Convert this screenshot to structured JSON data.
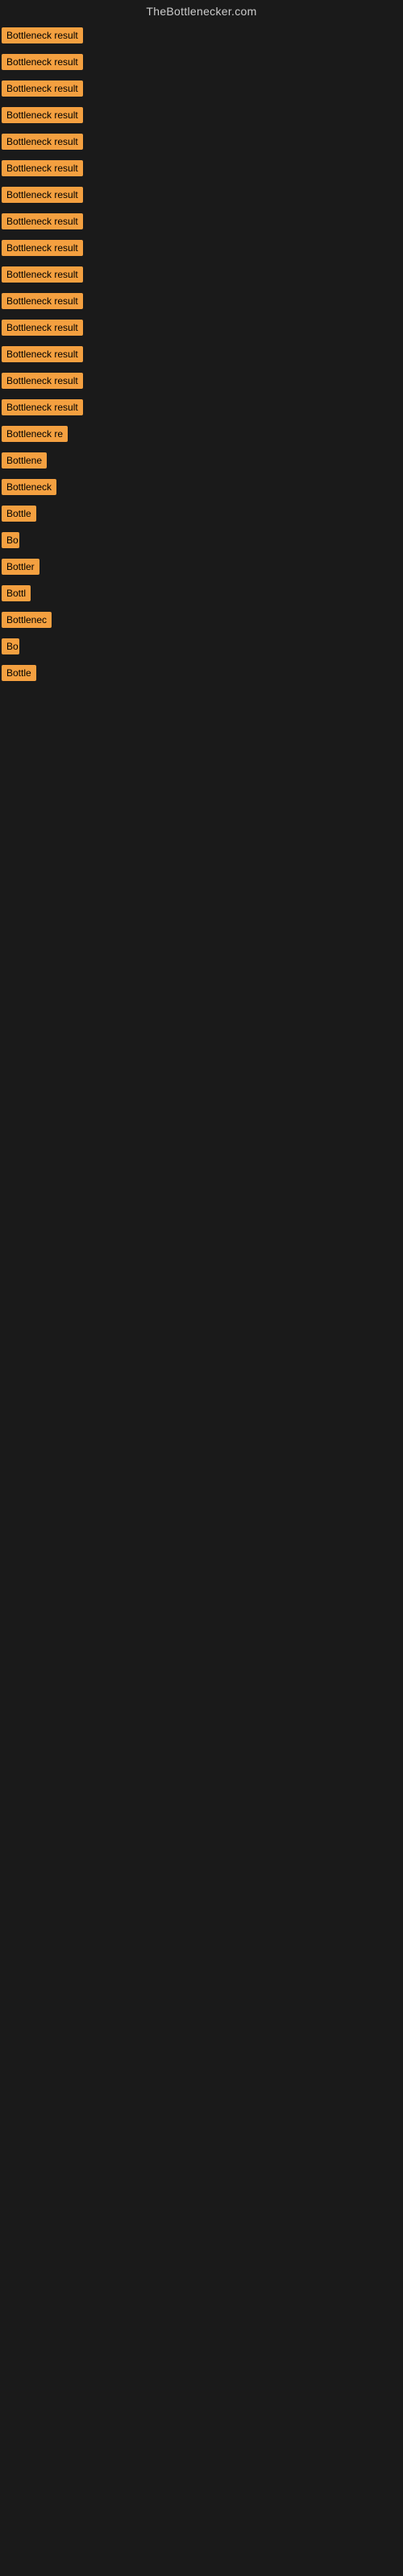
{
  "site": {
    "title": "TheBottlenecker.com"
  },
  "items": [
    {
      "label": "Bottleneck result",
      "width": 115
    },
    {
      "label": "Bottleneck result",
      "width": 115
    },
    {
      "label": "Bottleneck result",
      "width": 115
    },
    {
      "label": "Bottleneck result",
      "width": 115
    },
    {
      "label": "Bottleneck result",
      "width": 115
    },
    {
      "label": "Bottleneck result",
      "width": 115
    },
    {
      "label": "Bottleneck result",
      "width": 115
    },
    {
      "label": "Bottleneck result",
      "width": 115
    },
    {
      "label": "Bottleneck result",
      "width": 115
    },
    {
      "label": "Bottleneck result",
      "width": 115
    },
    {
      "label": "Bottleneck result",
      "width": 115
    },
    {
      "label": "Bottleneck result",
      "width": 115
    },
    {
      "label": "Bottleneck result",
      "width": 115
    },
    {
      "label": "Bottleneck result",
      "width": 115
    },
    {
      "label": "Bottleneck result",
      "width": 115
    },
    {
      "label": "Bottleneck re",
      "width": 88
    },
    {
      "label": "Bottlene",
      "width": 65
    },
    {
      "label": "Bottleneck",
      "width": 72
    },
    {
      "label": "Bottle",
      "width": 52
    },
    {
      "label": "Bo",
      "width": 22
    },
    {
      "label": "Bottler",
      "width": 55
    },
    {
      "label": "Bottl",
      "width": 44
    },
    {
      "label": "Bottlenec",
      "width": 70
    },
    {
      "label": "Bo",
      "width": 22
    },
    {
      "label": "Bottle",
      "width": 50
    }
  ]
}
